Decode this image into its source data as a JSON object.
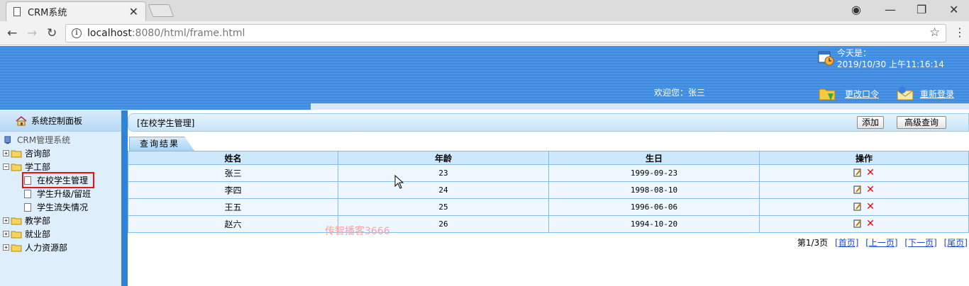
{
  "browser": {
    "tab_title": "CRM系统",
    "url_host": "localhost",
    "url_path": ":8080/html/frame.html"
  },
  "header": {
    "today_label": "今天是：",
    "datetime": "2019/10/30 上午11:16:14",
    "welcome": "欢迎您：张三",
    "change_password": "更改口令",
    "relogin": "重新登录"
  },
  "sidebar": {
    "panel_title": "系统控制面板",
    "root": "CRM管理系统",
    "nodes": [
      {
        "label": "咨询部",
        "expanded": false
      },
      {
        "label": "学工部",
        "expanded": true,
        "children": [
          "在校学生管理",
          "学生升级/留班",
          "学生流失情况"
        ]
      },
      {
        "label": "教学部",
        "expanded": false
      },
      {
        "label": "就业部",
        "expanded": false
      },
      {
        "label": "人力资源部",
        "expanded": false
      }
    ],
    "selected": "在校学生管理"
  },
  "main": {
    "breadcrumb": "[在校学生管理]",
    "add_button": "添加",
    "advanced_search_button": "高级查询",
    "results_tab": "查询结果",
    "columns": [
      "姓名",
      "年龄",
      "生日",
      "操作"
    ],
    "rows": [
      {
        "name": "张三",
        "age": "23",
        "birthday": "1999-09-23"
      },
      {
        "name": "李四",
        "age": "24",
        "birthday": "1998-08-10"
      },
      {
        "name": "王五",
        "age": "25",
        "birthday": "1996-06-06"
      },
      {
        "name": "赵六",
        "age": "26",
        "birthday": "1994-10-20"
      }
    ],
    "pager": {
      "status": "第1/3页",
      "first": "[首页]",
      "prev": "[上一页]",
      "next": "[下一页]",
      "last": "[尾页]"
    },
    "watermark": "传智播客3666"
  },
  "colors": {
    "header_blue": "#4a94e6",
    "table_border": "#84bde8",
    "selected_outline": "#e11"
  }
}
